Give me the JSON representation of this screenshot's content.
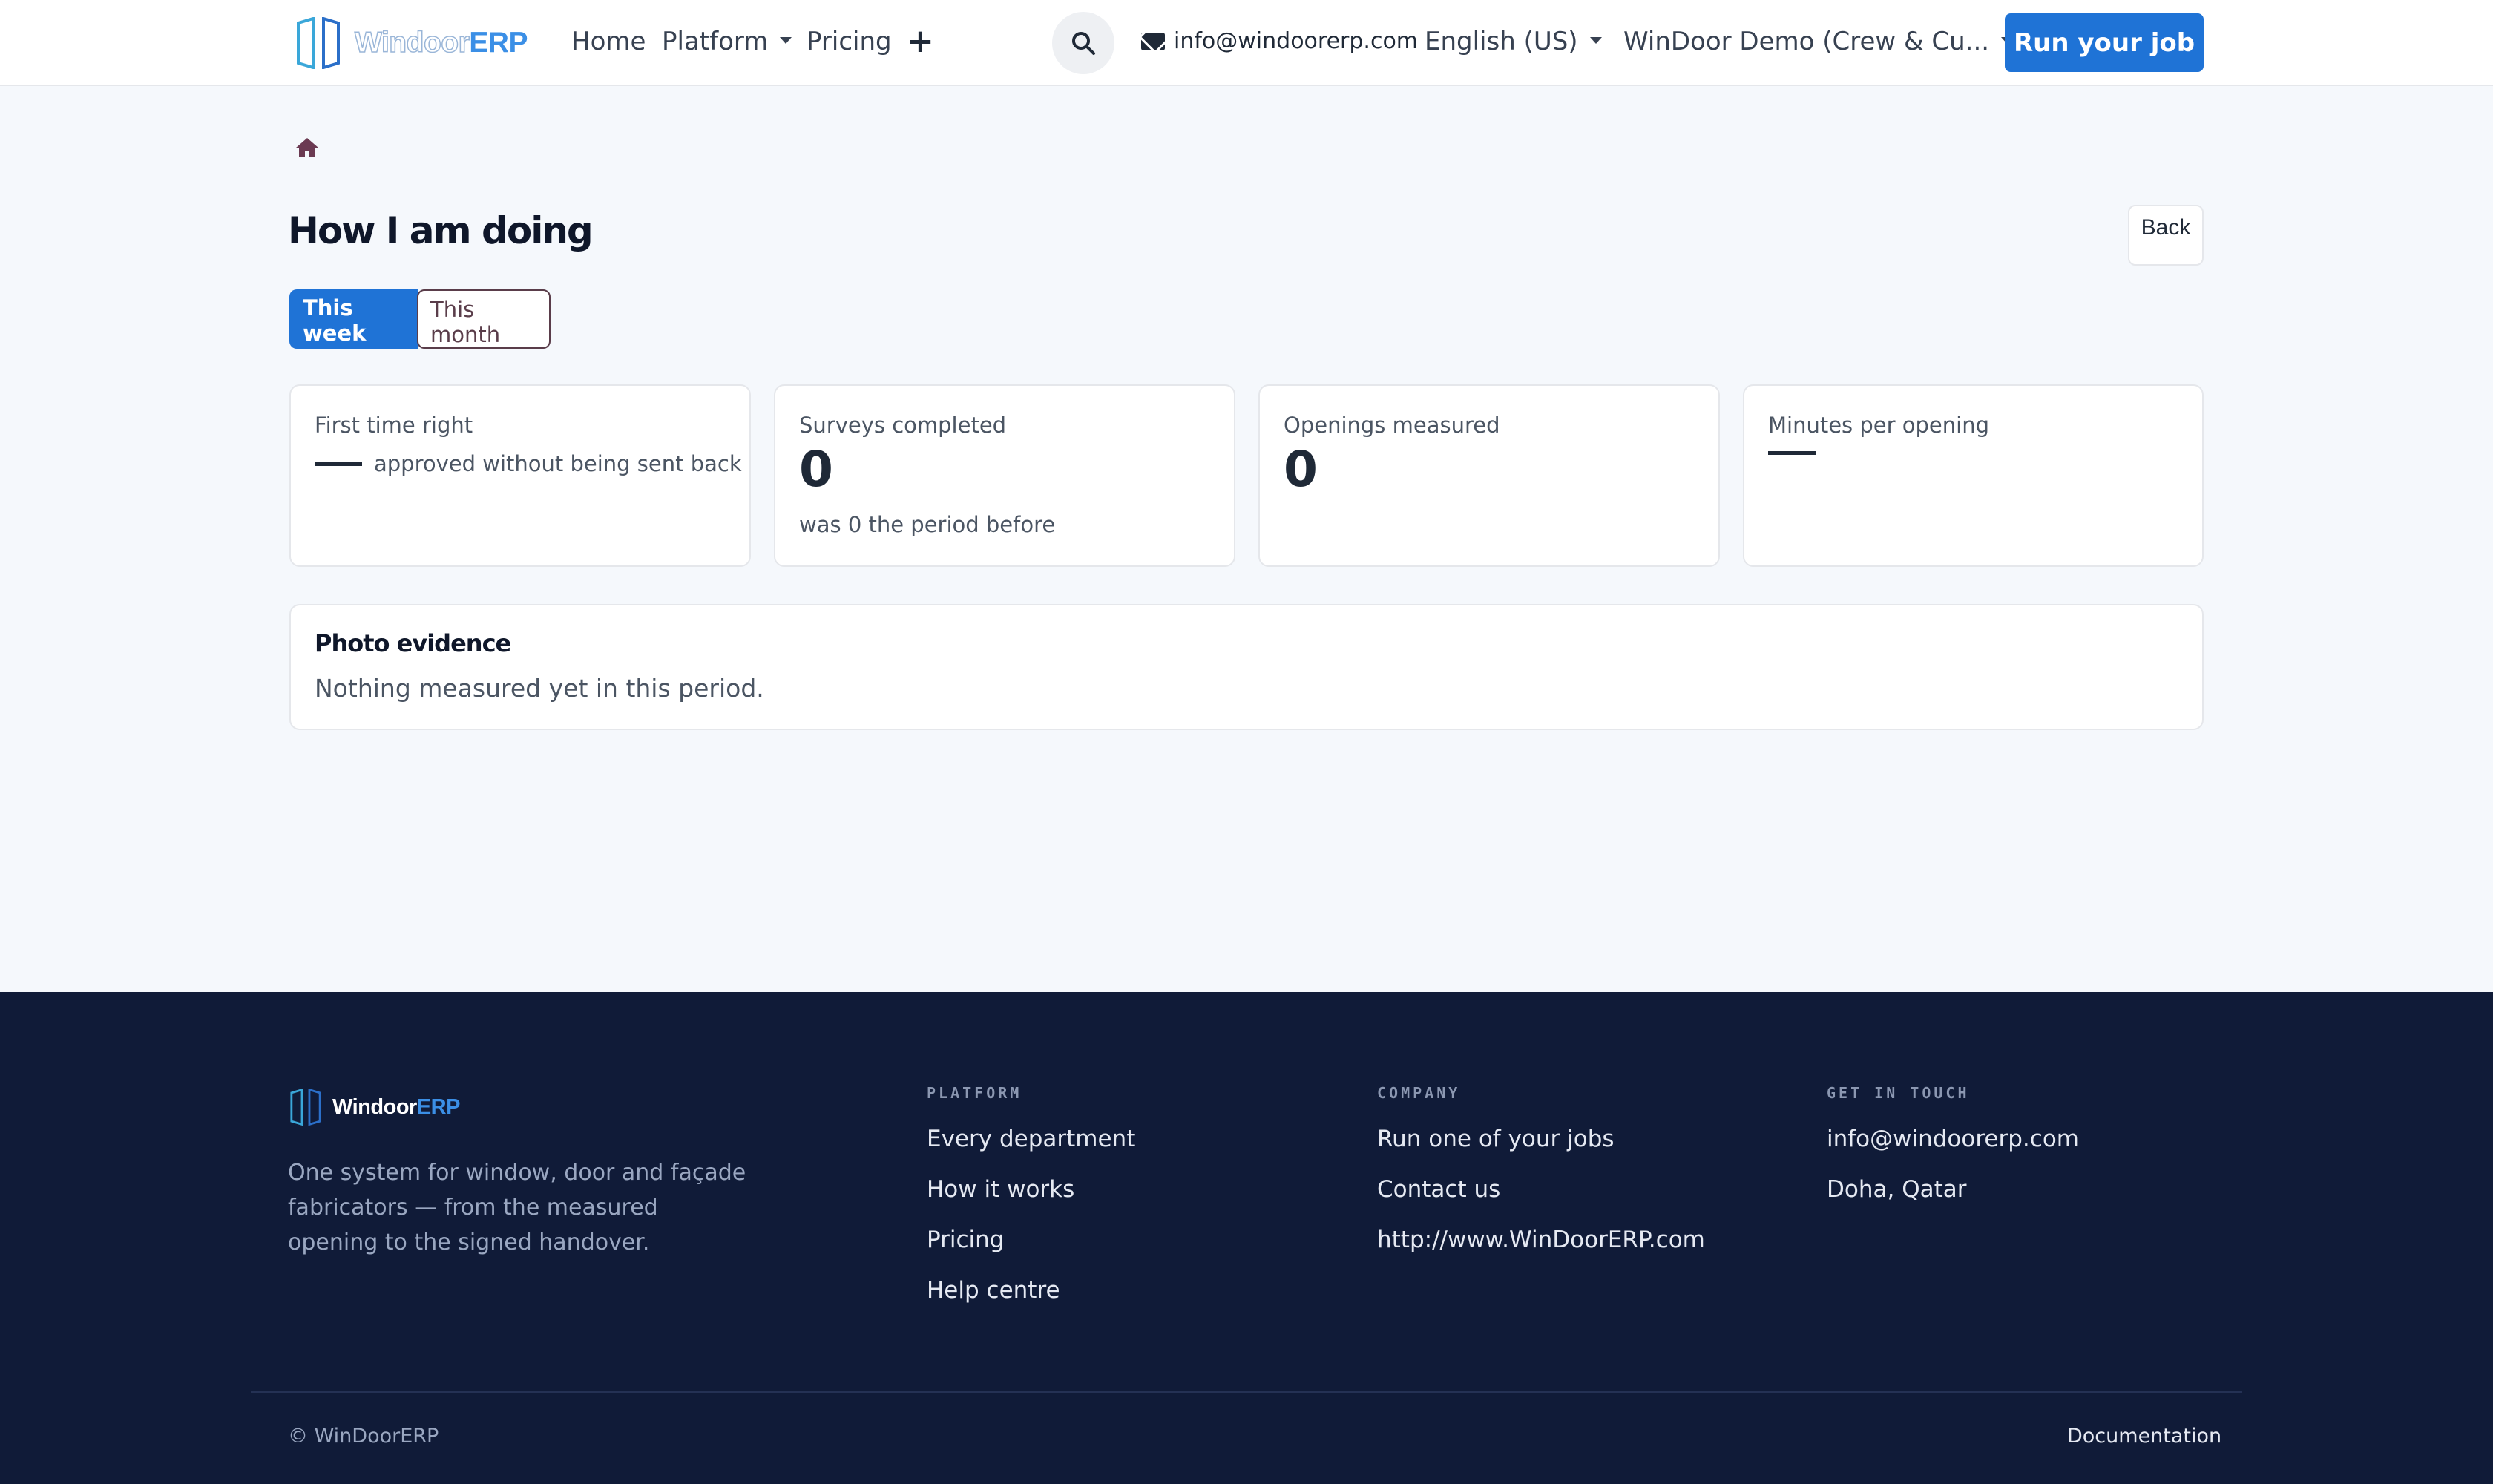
{
  "brand": {
    "name_part1": "Windoor",
    "name_part2": "ERP"
  },
  "nav": {
    "home": "Home",
    "platform": "Platform",
    "pricing": "Pricing",
    "email": "info@windoorerp.com",
    "language": "English (US)",
    "company": "WinDoor Demo (Crew & Cu...",
    "cta": "Run your job"
  },
  "page": {
    "title": "How I am doing",
    "back": "Back",
    "tabs": {
      "week": "This week",
      "month": "This month"
    }
  },
  "cards": [
    {
      "label": "First time right",
      "sub": "approved without being sent back"
    },
    {
      "label": "Surveys completed",
      "value": "0",
      "note": "was 0 the period before"
    },
    {
      "label": "Openings measured",
      "value": "0"
    },
    {
      "label": "Minutes per opening"
    }
  ],
  "photo": {
    "title": "Photo evidence",
    "message": "Nothing measured yet in this period."
  },
  "footer": {
    "description": "One system for window, door and façade fabricators — from the measured opening to the signed handover.",
    "platform_head": "PLATFORM",
    "platform_items": [
      "Every department",
      "How it works",
      "Pricing",
      "Help centre"
    ],
    "company_head": "COMPANY",
    "company_items": [
      "Run one of your jobs",
      "Contact us",
      "http://www.WinDoorERP.com"
    ],
    "contact_head": "GET IN TOUCH",
    "contact_items": [
      "info@windoorerp.com",
      "Doha, Qatar"
    ],
    "copyright": "© WinDoorERP",
    "documentation": "Documentation"
  },
  "colors": {
    "primary": "#1f73d6",
    "footer_bg": "#101b38",
    "page_bg": "#f5f8fc"
  }
}
